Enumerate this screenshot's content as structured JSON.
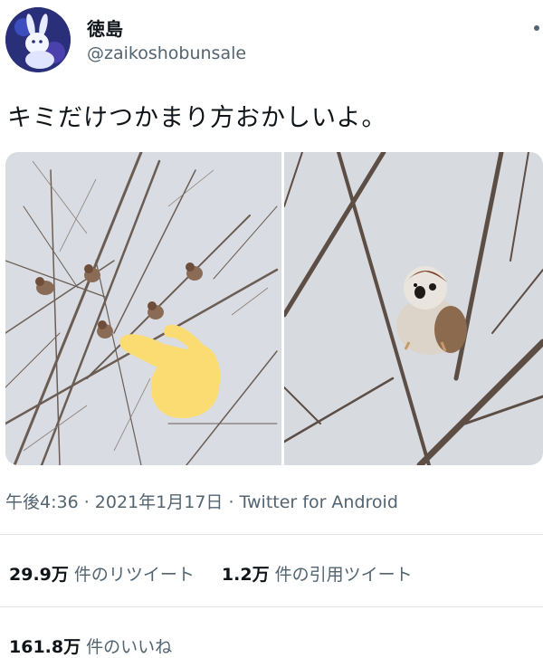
{
  "user": {
    "display_name": "徳島",
    "handle": "@zaikoshobunsale",
    "avatar_icon": "rabbit-avatar-icon"
  },
  "tweet": {
    "text": "キミだけつかまり方おかしいよ。"
  },
  "media": {
    "images": [
      {
        "subject": "sparrows-on-bare-branches",
        "overlay_icon": "pointing-hand-emoji-icon"
      },
      {
        "subject": "sparrow-clinging-to-branch"
      }
    ]
  },
  "meta": {
    "time": "午後4:36",
    "separator": " · ",
    "date": "2021年1月17日",
    "source": "Twitter for Android"
  },
  "stats": {
    "retweets_count": "29.9万",
    "retweets_label": "件のリツイート",
    "quotes_count": "1.2万",
    "quotes_label": "件の引用ツイート",
    "likes_count": "161.8万",
    "likes_label": "件のいいね"
  },
  "colors": {
    "text_primary": "#0f1419",
    "text_secondary": "#536471",
    "divider": "#e3e6e8",
    "hand_emoji": "#fbdc73"
  }
}
